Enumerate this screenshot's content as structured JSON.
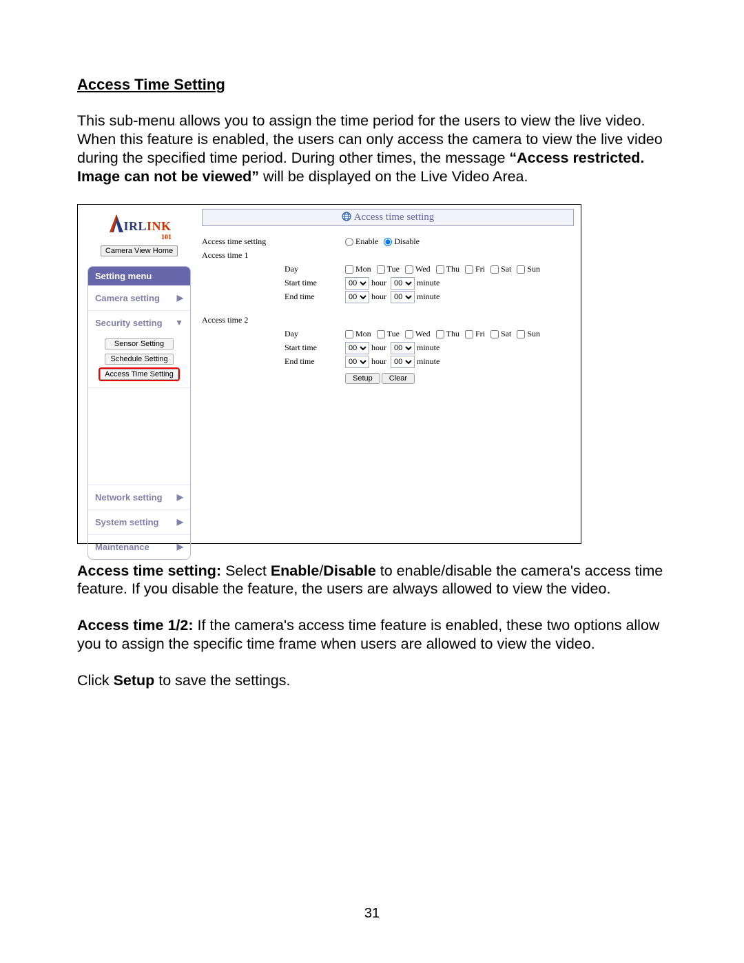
{
  "section_title": "Access Time Setting",
  "intro": {
    "part1": "This sub-menu allows you to assign the time period for the users to view the live video. When this feature is enabled, the users can only access the camera to view the live video during the specified time period. During other times, the message ",
    "bold_quote": "“Access restricted. Image can not be viewed”",
    "part2": " will be displayed on the Live Video Area."
  },
  "shot": {
    "logo": {
      "text_ir_l": "IRL",
      "text_ink": "INK",
      "sub": "101"
    },
    "camera_view_home": "Camera View Home",
    "menu": {
      "header": "Setting menu",
      "items": {
        "camera": "Camera setting",
        "security": "Security setting",
        "network": "Network setting",
        "system": "System setting",
        "maintenance": "Maintenance"
      },
      "sub": {
        "sensor": "Sensor Setting",
        "schedule": "Schedule Setting",
        "access_time": "Access Time Setting"
      }
    },
    "pane_title": "Access time setting",
    "form": {
      "access_time_setting": "Access time setting",
      "access_time_1": "Access time 1",
      "access_time_2": "Access time 2",
      "enable": "Enable",
      "disable": "Disable",
      "day": "Day",
      "start_time": "Start time",
      "end_time": "End time",
      "hour": "hour",
      "minute": "minute",
      "days": {
        "mon": "Mon",
        "tue": "Tue",
        "wed": "Wed",
        "thu": "Thu",
        "fri": "Fri",
        "sat": "Sat",
        "sun": "Sun"
      },
      "hour_value": "00",
      "minute_value": "00",
      "setup": "Setup",
      "clear": "Clear"
    }
  },
  "post": {
    "p1_bold_label": "Access time setting:",
    "p1_text1": " Select ",
    "p1_bold_enable": "Enable",
    "p1_slash": "/",
    "p1_bold_disable": "Disable",
    "p1_text2": " to enable/disable the camera's access time feature. If you disable the feature, the users are always allowed to view the video.",
    "p2_bold_label": "Access time 1/2:",
    "p2_text": " If the camera's access time feature is enabled, these two options allow you to assign the specific time frame when users are allowed to view the video.",
    "p3_text1": "Click ",
    "p3_bold": "Setup",
    "p3_text2": " to save the settings."
  },
  "page_number": "31"
}
